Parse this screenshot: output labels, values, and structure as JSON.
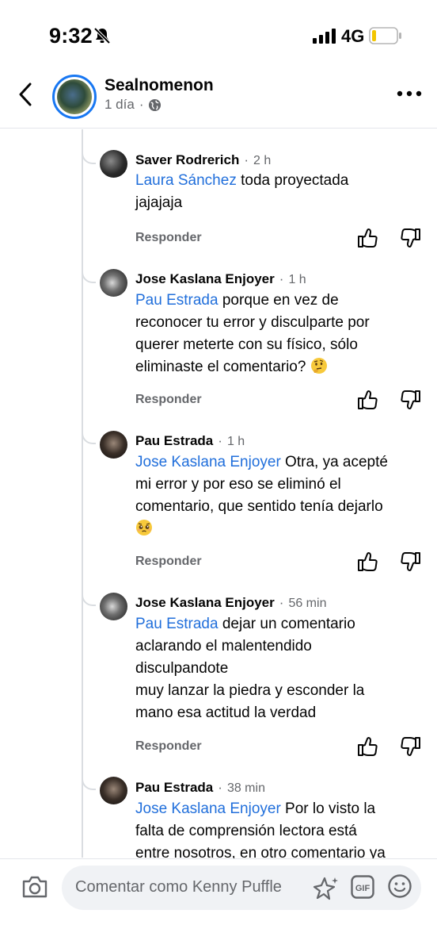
{
  "status_bar": {
    "time": "9:32",
    "network": "4G"
  },
  "header": {
    "name": "Sealnomenon",
    "meta": "1 día"
  },
  "comments": [
    {
      "author": "Saver Rodrerich",
      "time": "2 h",
      "mention": "Laura Sánchez",
      "line1_rest": " toda proyectada",
      "lines": [
        "jajajaja"
      ],
      "reply": "Responder"
    },
    {
      "author": "Jose Kaslana Enjoyer",
      "time": "1 h",
      "mention": "Pau Estrada",
      "line1_rest": " porque en vez de",
      "lines": [
        "reconocer tu error y disculparte por",
        "querer meterte con su físico, sólo",
        "eliminaste el comentario? "
      ],
      "reply": "Responder"
    },
    {
      "author": "Pau Estrada",
      "time": "1 h",
      "mention": "Jose Kaslana Enjoyer",
      "line1_rest": " Otra, ya acepté",
      "lines": [
        "mi error y por eso se eliminó el",
        "comentario, que sentido tenía dejarlo"
      ],
      "reply": "Responder"
    },
    {
      "author": "Jose Kaslana Enjoyer",
      "time": "56 min",
      "mention": "Pau Estrada",
      "line1_rest": " dejar un comentario",
      "lines": [
        "aclarando el malentendido",
        "disculpandote",
        "muy lanzar la piedra y esconder la",
        "mano esa actitud la verdad"
      ],
      "reply": "Responder"
    },
    {
      "author": "Pau Estrada",
      "time": "38 min",
      "mention": "Jose Kaslana Enjoyer",
      "line1_rest": " Por lo visto la",
      "lines": [
        "falta de comprensión lectora está",
        "entre nosotros, en otro comentario ya"
      ],
      "reply": ""
    }
  ],
  "composer": {
    "placeholder": "Comentar como Kenny Puffle"
  },
  "colors": {
    "mention": "#216fdb",
    "secondary_text": "#65676b",
    "brand": "#1877f2"
  }
}
